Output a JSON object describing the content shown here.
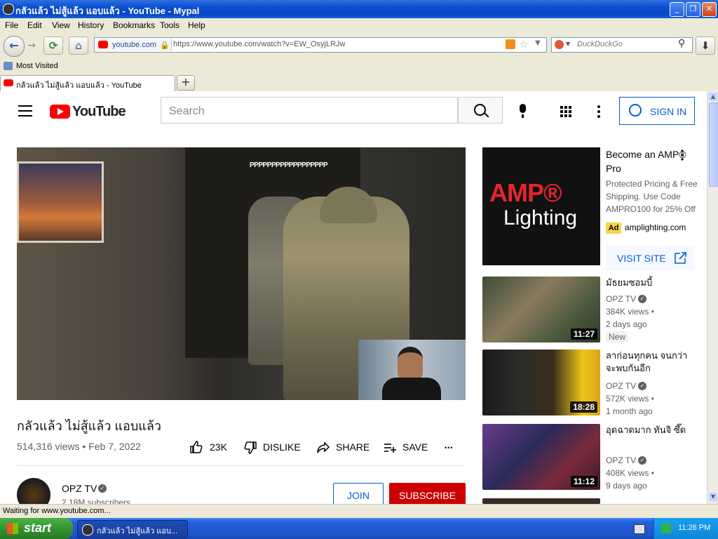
{
  "window": {
    "title": "กลัวแล้ว ไม่สู้แล้ว แอบแล้ว - YouTube - Mypal",
    "minimize": "_",
    "maximize": "❐",
    "close": "✕"
  },
  "menu": {
    "items": [
      "File",
      "Edit",
      "View",
      "History",
      "Bookmarks",
      "Tools",
      "Help"
    ]
  },
  "nav": {
    "site_label": "youtube.com",
    "url": "https://www.youtube.com/watch?v=EW_OsyjLRJw",
    "search_placeholder": "DuckDuckGo"
  },
  "bookmarks": {
    "most_visited": "Most Visited"
  },
  "tab": {
    "title": "กลัวแล้ว ไม่สู้แล้ว แอบแล้ว - YouTube",
    "new_tab": "+"
  },
  "yt_header": {
    "logo_text": "YouTube",
    "search_placeholder": "Search",
    "sign_in": "SIGN IN"
  },
  "video": {
    "overlay_text": "PPPPPPPPPPPPPPPPPP",
    "title": "กลัวแล้ว ไม่สู้แล้ว แอบแล้ว",
    "views": "514,316 views • Feb 7, 2022",
    "likes": "23K",
    "dislike": "DISLIKE",
    "share": "SHARE",
    "save": "SAVE",
    "more": "•••"
  },
  "channel": {
    "name": "OPZ TV",
    "subscribers": "2.18M subscribers",
    "join": "JOIN",
    "subscribe": "SUBSCRIBE"
  },
  "ad": {
    "brand_line1": "AMP®",
    "brand_line2": "Lighting",
    "title": "Become an AMP® Pro",
    "desc": "Protected Pricing & Free Shipping. Use Code AMPRO100 for 25% Off",
    "badge": "Ad",
    "domain": "amplighting.com",
    "visit": "VISIT SITE"
  },
  "recommendations": [
    {
      "title": "มัธยมซอมบี้",
      "channel": "OPZ TV",
      "views": "384K views •",
      "age": "2 days ago",
      "badge": "New",
      "duration": "11:27"
    },
    {
      "title": "ลาก่อนทุกคน จนกว่าจะพบกันอีก",
      "channel": "OPZ TV",
      "views": "572K views •",
      "age": "1 month ago",
      "badge": "",
      "duration": "18:28"
    },
    {
      "title": "อุดฉาดมาก ทันจิ ซึ๊ด",
      "channel": "OPZ TV",
      "views": "408K views •",
      "age": "9 days ago",
      "badge": "",
      "duration": "11:12"
    }
  ],
  "status": {
    "text": "Waiting for www.youtube.com..."
  },
  "taskbar": {
    "start": "start",
    "window_item": "กลัวแล้ว ไม่สู้แล้ว แอบ...",
    "clock": "11:26 PM"
  },
  "colors": {
    "yt_red": "#ff0000",
    "subscribe_red": "#cc0000",
    "link_blue": "#065fd4",
    "xp_blue": "#245edb"
  }
}
